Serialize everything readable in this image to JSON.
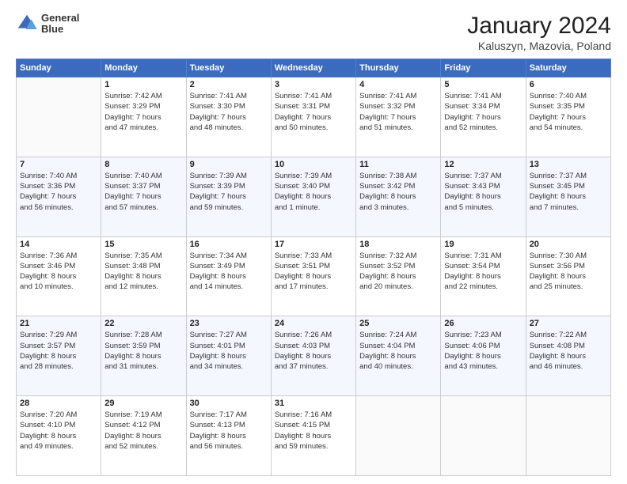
{
  "logo": {
    "line1": "General",
    "line2": "Blue"
  },
  "title": "January 2024",
  "subtitle": "Kaluszyn, Mazovia, Poland",
  "days_header": [
    "Sunday",
    "Monday",
    "Tuesday",
    "Wednesday",
    "Thursday",
    "Friday",
    "Saturday"
  ],
  "weeks": [
    [
      {
        "day": "",
        "info": ""
      },
      {
        "day": "1",
        "info": "Sunrise: 7:42 AM\nSunset: 3:29 PM\nDaylight: 7 hours\nand 47 minutes."
      },
      {
        "day": "2",
        "info": "Sunrise: 7:41 AM\nSunset: 3:30 PM\nDaylight: 7 hours\nand 48 minutes."
      },
      {
        "day": "3",
        "info": "Sunrise: 7:41 AM\nSunset: 3:31 PM\nDaylight: 7 hours\nand 50 minutes."
      },
      {
        "day": "4",
        "info": "Sunrise: 7:41 AM\nSunset: 3:32 PM\nDaylight: 7 hours\nand 51 minutes."
      },
      {
        "day": "5",
        "info": "Sunrise: 7:41 AM\nSunset: 3:34 PM\nDaylight: 7 hours\nand 52 minutes."
      },
      {
        "day": "6",
        "info": "Sunrise: 7:40 AM\nSunset: 3:35 PM\nDaylight: 7 hours\nand 54 minutes."
      }
    ],
    [
      {
        "day": "7",
        "info": "Sunrise: 7:40 AM\nSunset: 3:36 PM\nDaylight: 7 hours\nand 56 minutes."
      },
      {
        "day": "8",
        "info": "Sunrise: 7:40 AM\nSunset: 3:37 PM\nDaylight: 7 hours\nand 57 minutes."
      },
      {
        "day": "9",
        "info": "Sunrise: 7:39 AM\nSunset: 3:39 PM\nDaylight: 7 hours\nand 59 minutes."
      },
      {
        "day": "10",
        "info": "Sunrise: 7:39 AM\nSunset: 3:40 PM\nDaylight: 8 hours\nand 1 minute."
      },
      {
        "day": "11",
        "info": "Sunrise: 7:38 AM\nSunset: 3:42 PM\nDaylight: 8 hours\nand 3 minutes."
      },
      {
        "day": "12",
        "info": "Sunrise: 7:37 AM\nSunset: 3:43 PM\nDaylight: 8 hours\nand 5 minutes."
      },
      {
        "day": "13",
        "info": "Sunrise: 7:37 AM\nSunset: 3:45 PM\nDaylight: 8 hours\nand 7 minutes."
      }
    ],
    [
      {
        "day": "14",
        "info": "Sunrise: 7:36 AM\nSunset: 3:46 PM\nDaylight: 8 hours\nand 10 minutes."
      },
      {
        "day": "15",
        "info": "Sunrise: 7:35 AM\nSunset: 3:48 PM\nDaylight: 8 hours\nand 12 minutes."
      },
      {
        "day": "16",
        "info": "Sunrise: 7:34 AM\nSunset: 3:49 PM\nDaylight: 8 hours\nand 14 minutes."
      },
      {
        "day": "17",
        "info": "Sunrise: 7:33 AM\nSunset: 3:51 PM\nDaylight: 8 hours\nand 17 minutes."
      },
      {
        "day": "18",
        "info": "Sunrise: 7:32 AM\nSunset: 3:52 PM\nDaylight: 8 hours\nand 20 minutes."
      },
      {
        "day": "19",
        "info": "Sunrise: 7:31 AM\nSunset: 3:54 PM\nDaylight: 8 hours\nand 22 minutes."
      },
      {
        "day": "20",
        "info": "Sunrise: 7:30 AM\nSunset: 3:56 PM\nDaylight: 8 hours\nand 25 minutes."
      }
    ],
    [
      {
        "day": "21",
        "info": "Sunrise: 7:29 AM\nSunset: 3:57 PM\nDaylight: 8 hours\nand 28 minutes."
      },
      {
        "day": "22",
        "info": "Sunrise: 7:28 AM\nSunset: 3:59 PM\nDaylight: 8 hours\nand 31 minutes."
      },
      {
        "day": "23",
        "info": "Sunrise: 7:27 AM\nSunset: 4:01 PM\nDaylight: 8 hours\nand 34 minutes."
      },
      {
        "day": "24",
        "info": "Sunrise: 7:26 AM\nSunset: 4:03 PM\nDaylight: 8 hours\nand 37 minutes."
      },
      {
        "day": "25",
        "info": "Sunrise: 7:24 AM\nSunset: 4:04 PM\nDaylight: 8 hours\nand 40 minutes."
      },
      {
        "day": "26",
        "info": "Sunrise: 7:23 AM\nSunset: 4:06 PM\nDaylight: 8 hours\nand 43 minutes."
      },
      {
        "day": "27",
        "info": "Sunrise: 7:22 AM\nSunset: 4:08 PM\nDaylight: 8 hours\nand 46 minutes."
      }
    ],
    [
      {
        "day": "28",
        "info": "Sunrise: 7:20 AM\nSunset: 4:10 PM\nDaylight: 8 hours\nand 49 minutes."
      },
      {
        "day": "29",
        "info": "Sunrise: 7:19 AM\nSunset: 4:12 PM\nDaylight: 8 hours\nand 52 minutes."
      },
      {
        "day": "30",
        "info": "Sunrise: 7:17 AM\nSunset: 4:13 PM\nDaylight: 8 hours\nand 56 minutes."
      },
      {
        "day": "31",
        "info": "Sunrise: 7:16 AM\nSunset: 4:15 PM\nDaylight: 8 hours\nand 59 minutes."
      },
      {
        "day": "",
        "info": ""
      },
      {
        "day": "",
        "info": ""
      },
      {
        "day": "",
        "info": ""
      }
    ]
  ]
}
